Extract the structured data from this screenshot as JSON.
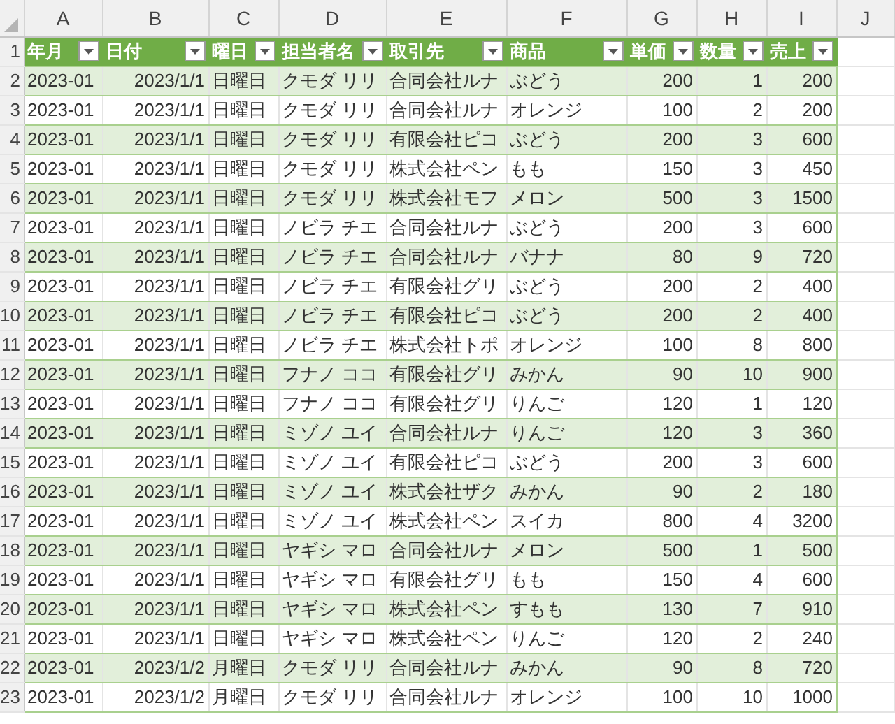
{
  "column_letters": [
    "A",
    "B",
    "C",
    "D",
    "E",
    "F",
    "G",
    "H",
    "I",
    "J"
  ],
  "table": {
    "header_row_number": "1",
    "columns": [
      {
        "label": "年月",
        "kind": "text"
      },
      {
        "label": "日付",
        "kind": "number"
      },
      {
        "label": "曜日",
        "kind": "text"
      },
      {
        "label": "担当者名",
        "kind": "text"
      },
      {
        "label": "取引先",
        "kind": "text"
      },
      {
        "label": "商品",
        "kind": "text"
      },
      {
        "label": "単価",
        "kind": "number"
      },
      {
        "label": "数量",
        "kind": "number"
      },
      {
        "label": "売上",
        "kind": "number"
      }
    ],
    "rows": [
      {
        "number": "2",
        "cells": [
          "2023-01",
          "2023/1/1",
          "日曜日",
          "クモダ リリ",
          "合同会社ルナ",
          "ぶどう",
          "200",
          "1",
          "200"
        ]
      },
      {
        "number": "3",
        "cells": [
          "2023-01",
          "2023/1/1",
          "日曜日",
          "クモダ リリ",
          "合同会社ルナ",
          "オレンジ",
          "100",
          "2",
          "200"
        ]
      },
      {
        "number": "4",
        "cells": [
          "2023-01",
          "2023/1/1",
          "日曜日",
          "クモダ リリ",
          "有限会社ピコ",
          "ぶどう",
          "200",
          "3",
          "600"
        ]
      },
      {
        "number": "5",
        "cells": [
          "2023-01",
          "2023/1/1",
          "日曜日",
          "クモダ リリ",
          "株式会社ペン",
          "もも",
          "150",
          "3",
          "450"
        ]
      },
      {
        "number": "6",
        "cells": [
          "2023-01",
          "2023/1/1",
          "日曜日",
          "クモダ リリ",
          "株式会社モフ",
          "メロン",
          "500",
          "3",
          "1500"
        ]
      },
      {
        "number": "7",
        "cells": [
          "2023-01",
          "2023/1/1",
          "日曜日",
          "ノビラ チエ",
          "合同会社ルナ",
          "ぶどう",
          "200",
          "3",
          "600"
        ]
      },
      {
        "number": "8",
        "cells": [
          "2023-01",
          "2023/1/1",
          "日曜日",
          "ノビラ チエ",
          "合同会社ルナ",
          "バナナ",
          "80",
          "9",
          "720"
        ]
      },
      {
        "number": "9",
        "cells": [
          "2023-01",
          "2023/1/1",
          "日曜日",
          "ノビラ チエ",
          "有限会社グリ",
          "ぶどう",
          "200",
          "2",
          "400"
        ]
      },
      {
        "number": "10",
        "cells": [
          "2023-01",
          "2023/1/1",
          "日曜日",
          "ノビラ チエ",
          "有限会社ピコ",
          "ぶどう",
          "200",
          "2",
          "400"
        ]
      },
      {
        "number": "11",
        "cells": [
          "2023-01",
          "2023/1/1",
          "日曜日",
          "ノビラ チエ",
          "株式会社トポ",
          "オレンジ",
          "100",
          "8",
          "800"
        ]
      },
      {
        "number": "12",
        "cells": [
          "2023-01",
          "2023/1/1",
          "日曜日",
          "フナノ ココ",
          "有限会社グリ",
          "みかん",
          "90",
          "10",
          "900"
        ]
      },
      {
        "number": "13",
        "cells": [
          "2023-01",
          "2023/1/1",
          "日曜日",
          "フナノ ココ",
          "有限会社グリ",
          "りんご",
          "120",
          "1",
          "120"
        ]
      },
      {
        "number": "14",
        "cells": [
          "2023-01",
          "2023/1/1",
          "日曜日",
          "ミゾノ ユイ",
          "合同会社ルナ",
          "りんご",
          "120",
          "3",
          "360"
        ]
      },
      {
        "number": "15",
        "cells": [
          "2023-01",
          "2023/1/1",
          "日曜日",
          "ミゾノ ユイ",
          "有限会社ピコ",
          "ぶどう",
          "200",
          "3",
          "600"
        ]
      },
      {
        "number": "16",
        "cells": [
          "2023-01",
          "2023/1/1",
          "日曜日",
          "ミゾノ ユイ",
          "株式会社ザク",
          "みかん",
          "90",
          "2",
          "180"
        ]
      },
      {
        "number": "17",
        "cells": [
          "2023-01",
          "2023/1/1",
          "日曜日",
          "ミゾノ ユイ",
          "株式会社ペン",
          "スイカ",
          "800",
          "4",
          "3200"
        ]
      },
      {
        "number": "18",
        "cells": [
          "2023-01",
          "2023/1/1",
          "日曜日",
          "ヤギシ マロ",
          "合同会社ルナ",
          "メロン",
          "500",
          "1",
          "500"
        ]
      },
      {
        "number": "19",
        "cells": [
          "2023-01",
          "2023/1/1",
          "日曜日",
          "ヤギシ マロ",
          "有限会社グリ",
          "もも",
          "150",
          "4",
          "600"
        ]
      },
      {
        "number": "20",
        "cells": [
          "2023-01",
          "2023/1/1",
          "日曜日",
          "ヤギシ マロ",
          "株式会社ペン",
          "すもも",
          "130",
          "7",
          "910"
        ]
      },
      {
        "number": "21",
        "cells": [
          "2023-01",
          "2023/1/1",
          "日曜日",
          "ヤギシ マロ",
          "株式会社ペン",
          "りんご",
          "120",
          "2",
          "240"
        ]
      },
      {
        "number": "22",
        "cells": [
          "2023-01",
          "2023/1/2",
          "月曜日",
          "クモダ リリ",
          "合同会社ルナ",
          "みかん",
          "90",
          "8",
          "720"
        ]
      },
      {
        "number": "23",
        "cells": [
          "2023-01",
          "2023/1/2",
          "月曜日",
          "クモダ リリ",
          "合同会社ルナ",
          "オレンジ",
          "100",
          "10",
          "1000"
        ]
      }
    ]
  }
}
